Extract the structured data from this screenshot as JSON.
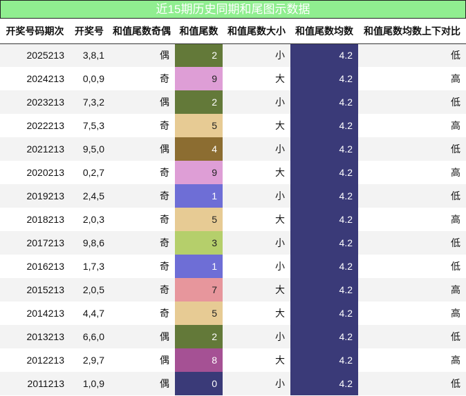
{
  "title": "近15期历史同期和尾图示数据",
  "headers": [
    "开奖号码期次",
    "开奖号",
    "和值尾数奇偶",
    "和值尾数",
    "和值尾数大小",
    "和值尾数均数",
    "和值尾数均数上下对比"
  ],
  "colors": {
    "title_bg": "#90ee90",
    "avg_bg": "#3a3a78",
    "tail": {
      "0": "#3a3a78",
      "1": "#6e6ed6",
      "2": "#637939",
      "3": "#b5cf6b",
      "4": "#8c6d31",
      "5": "#e7cb94",
      "7": "#e7969c",
      "8": "#a55194",
      "9": "#de9ed6"
    },
    "tail_text": {
      "0": "#ffffff",
      "1": "#ffffff",
      "2": "#ffffff",
      "3": "#222222",
      "4": "#ffffff",
      "5": "#222222",
      "7": "#222222",
      "8": "#ffffff",
      "9": "#222222"
    }
  },
  "rows": [
    {
      "issue": "2025213",
      "nums": "3,8,1",
      "parity": "偶",
      "tail": "2",
      "size": "小",
      "avg": "4.2",
      "cmp": "低"
    },
    {
      "issue": "2024213",
      "nums": "0,0,9",
      "parity": "奇",
      "tail": "9",
      "size": "大",
      "avg": "4.2",
      "cmp": "高"
    },
    {
      "issue": "2023213",
      "nums": "7,3,2",
      "parity": "偶",
      "tail": "2",
      "size": "小",
      "avg": "4.2",
      "cmp": "低"
    },
    {
      "issue": "2022213",
      "nums": "7,5,3",
      "parity": "奇",
      "tail": "5",
      "size": "大",
      "avg": "4.2",
      "cmp": "高"
    },
    {
      "issue": "2021213",
      "nums": "9,5,0",
      "parity": "偶",
      "tail": "4",
      "size": "小",
      "avg": "4.2",
      "cmp": "低"
    },
    {
      "issue": "2020213",
      "nums": "0,2,7",
      "parity": "奇",
      "tail": "9",
      "size": "大",
      "avg": "4.2",
      "cmp": "高"
    },
    {
      "issue": "2019213",
      "nums": "2,4,5",
      "parity": "奇",
      "tail": "1",
      "size": "小",
      "avg": "4.2",
      "cmp": "低"
    },
    {
      "issue": "2018213",
      "nums": "2,0,3",
      "parity": "奇",
      "tail": "5",
      "size": "大",
      "avg": "4.2",
      "cmp": "高"
    },
    {
      "issue": "2017213",
      "nums": "9,8,6",
      "parity": "奇",
      "tail": "3",
      "size": "小",
      "avg": "4.2",
      "cmp": "低"
    },
    {
      "issue": "2016213",
      "nums": "1,7,3",
      "parity": "奇",
      "tail": "1",
      "size": "小",
      "avg": "4.2",
      "cmp": "低"
    },
    {
      "issue": "2015213",
      "nums": "2,0,5",
      "parity": "奇",
      "tail": "7",
      "size": "大",
      "avg": "4.2",
      "cmp": "高"
    },
    {
      "issue": "2014213",
      "nums": "4,4,7",
      "parity": "奇",
      "tail": "5",
      "size": "大",
      "avg": "4.2",
      "cmp": "高"
    },
    {
      "issue": "2013213",
      "nums": "6,6,0",
      "parity": "偶",
      "tail": "2",
      "size": "小",
      "avg": "4.2",
      "cmp": "低"
    },
    {
      "issue": "2012213",
      "nums": "2,9,7",
      "parity": "偶",
      "tail": "8",
      "size": "大",
      "avg": "4.2",
      "cmp": "高"
    },
    {
      "issue": "2011213",
      "nums": "1,0,9",
      "parity": "偶",
      "tail": "0",
      "size": "小",
      "avg": "4.2",
      "cmp": "低"
    }
  ]
}
